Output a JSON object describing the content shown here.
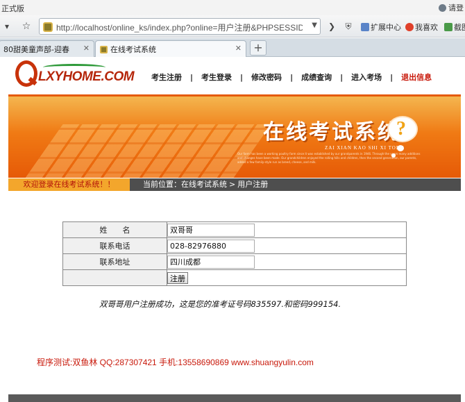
{
  "window": {
    "title_fragment": "正式版",
    "user_fragment": "请登"
  },
  "navbar": {
    "url": "http://localhost/online_ks/index.php?online=用户注册&PHPSESSID=65",
    "tools": {
      "extensions": "扩展中心",
      "favorites": "我喜欢",
      "screenshot": "截图"
    }
  },
  "tabs": [
    {
      "label": "80甜美童声部-迎春"
    },
    {
      "label": "在线考试系统"
    }
  ],
  "site": {
    "logo_text": "LXYHOME.COM",
    "menu": [
      "考生注册",
      "考生登录",
      "修改密码",
      "成绩查询",
      "进入考场",
      "退出信息"
    ],
    "banner": {
      "title": "在线考试系统",
      "pinyin": "ZAI XIAN KAO SHI XI TONG",
      "fine_print": "Our farm has been a working poultry farm since it was established by our grandparents in 1946. Through the years many additions and changes have been made. Our grandchildren enjoyed the rolling hills and children, then the second generation, our parents, added a few family-style run as breed, cheese, and milk."
    },
    "welcome": "欢迎登录在线考试系统！！",
    "breadcrumb": {
      "prefix": "当前位置：",
      "root": "在线考试系统",
      "separator": ">",
      "current": "用户注册"
    }
  },
  "form": {
    "name_label": "姓　　名",
    "name_value": "双哥哥",
    "phone_label": "联系电话",
    "phone_value": "028-82976880",
    "address_label": "联系地址",
    "address_value": "四川成都",
    "submit_label": "注册"
  },
  "result_message": "双哥哥用户注册成功，这是您的准考证号码835597.和密码999154.",
  "credit": "程序测试:双鱼林 QQ:287307421 手机:13558690869 www.shuangyulin.com",
  "colors": {
    "accent_red": "#c8180a",
    "banner_orange": "#f07a14",
    "status_bar": "#4e4e4e"
  }
}
